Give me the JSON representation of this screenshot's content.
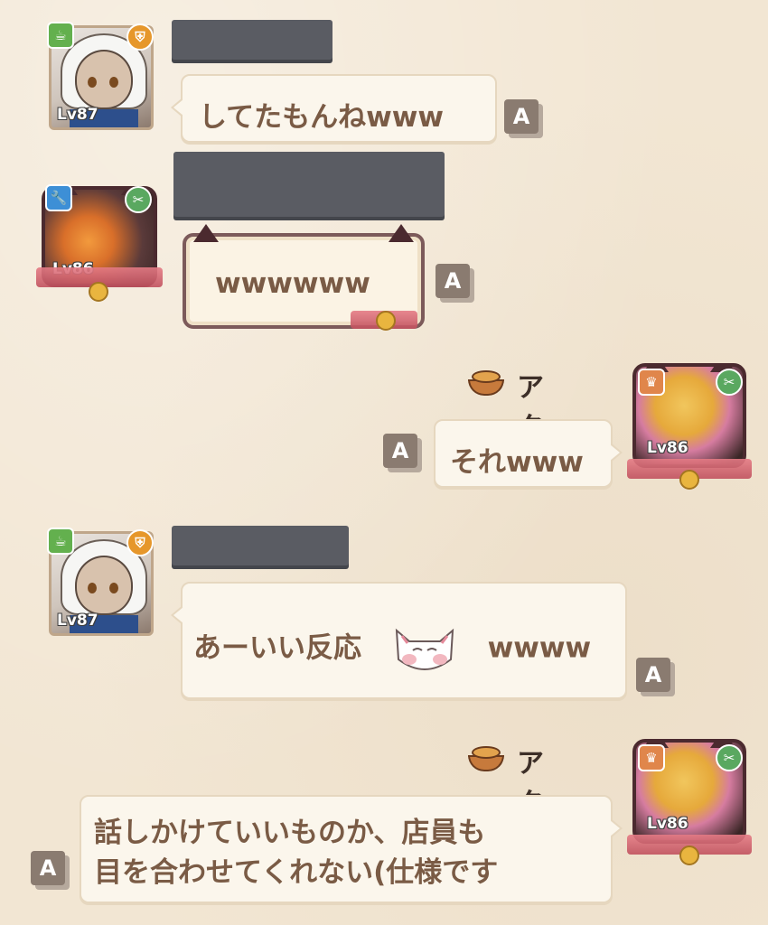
{
  "translate_label": "A",
  "messages": [
    {
      "level": "Lv87",
      "text": "してたもんねwww"
    },
    {
      "level": "Lv86",
      "text": "wwwwww"
    },
    {
      "sender": "アクト",
      "level": "Lv86",
      "text": "それwww"
    },
    {
      "level": "Lv87",
      "text_before": "あーいい反応",
      "text_after": "wwww",
      "sticker": "cat-sticker"
    },
    {
      "sender": "アクト",
      "level": "Lv86",
      "lines": [
        "話しかけていいものか、店員も",
        "目を合わせてくれない(仕様です"
      ]
    }
  ],
  "colors": {
    "background": "#f2e6d3",
    "bubble": "#fbf6ec",
    "name_redaction": "#5a5c63",
    "text": "#7a5b45"
  }
}
